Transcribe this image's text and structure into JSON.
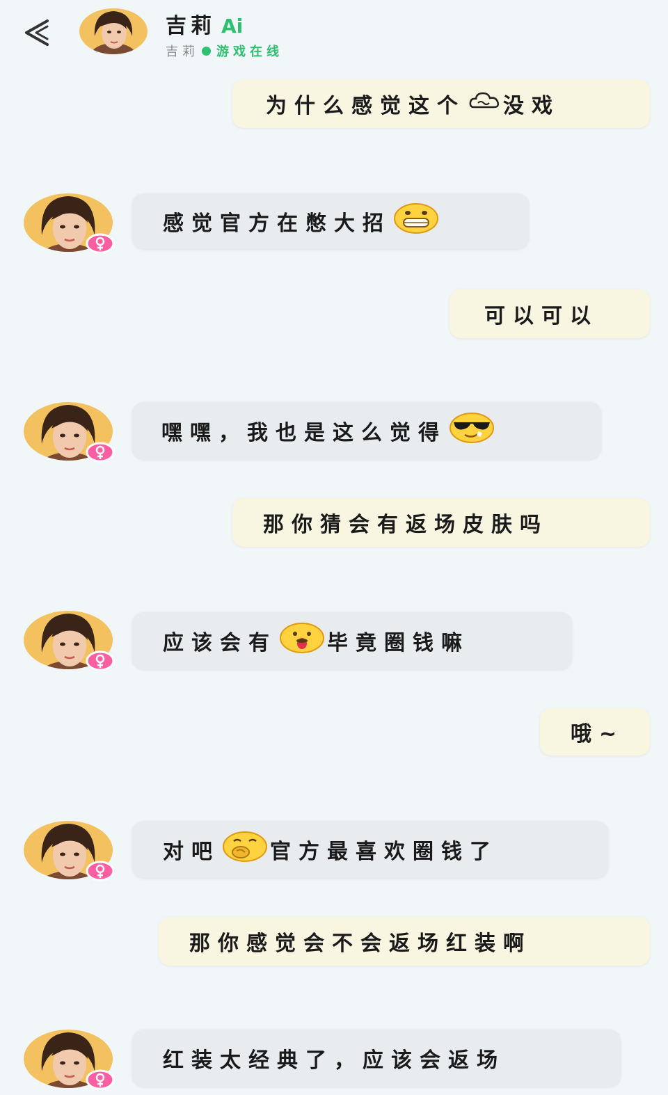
{
  "header": {
    "title": "吉莉",
    "title_tag": "Ai",
    "subtitle_name": "吉莉",
    "status": "游戏在线"
  },
  "messages": [
    {
      "role": "user",
      "parts": [
        {
          "t": "为什么感觉这个"
        },
        {
          "e": "cloud-icon"
        },
        {
          "t": "没戏"
        }
      ]
    },
    {
      "role": "ai",
      "parts": [
        {
          "t": "感觉官方在憋大招"
        },
        {
          "e": "grin-emoji"
        }
      ]
    },
    {
      "role": "user",
      "parts": [
        {
          "t": "可以可以"
        }
      ]
    },
    {
      "role": "ai",
      "parts": [
        {
          "t": "嘿嘿，我也是这么觉得"
        },
        {
          "e": "sunglasses-emoji"
        }
      ]
    },
    {
      "role": "user",
      "parts": [
        {
          "t": "那你猜会有返场皮肤吗"
        }
      ]
    },
    {
      "role": "ai",
      "parts": [
        {
          "t": "应该会有"
        },
        {
          "e": "tongue-emoji"
        },
        {
          "t": "毕竟圈钱嘛"
        }
      ]
    },
    {
      "role": "user",
      "parts": [
        {
          "t": "哦~"
        }
      ]
    },
    {
      "role": "ai",
      "parts": [
        {
          "t": "对吧"
        },
        {
          "e": "snicker-emoji"
        },
        {
          "t": "官方最喜欢圈钱了"
        }
      ]
    },
    {
      "role": "user",
      "parts": [
        {
          "t": "那你感觉会不会返场红装啊"
        }
      ]
    },
    {
      "role": "ai",
      "parts": [
        {
          "t": "红装太经典了，应该会返场"
        }
      ]
    }
  ],
  "colors": {
    "background": "#f1f6f9",
    "user_bubble": "#f8f5e1",
    "ai_bubble": "#e9ecef",
    "online": "#2fbf70",
    "female_badge": "#ff5fa2"
  }
}
